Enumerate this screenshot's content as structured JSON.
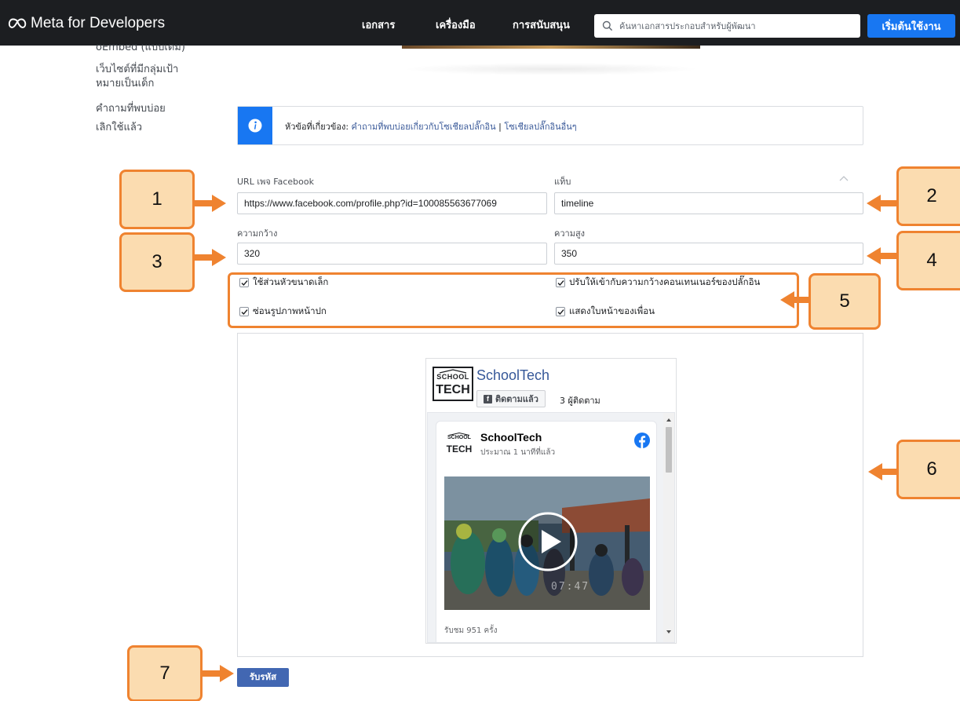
{
  "nav": {
    "brand": "Meta for Developers",
    "links": [
      "เอกสาร",
      "เครื่องมือ",
      "การสนับสนุน"
    ],
    "search_placeholder": "ค้นหาเอกสารประกอบสำหรับผู้พัฒนา",
    "start_button": "เริ่มต้นใช้งาน"
  },
  "sidebar": {
    "items": [
      "oEmbed (แบบเดิม)",
      "เว็บไซต์ที่มีกลุ่มเป้า",
      "หมายเป็นเด็ก",
      "คำถามที่พบบ่อย",
      "เลิกใช้แล้ว"
    ]
  },
  "info": {
    "prefix": "หัวข้อที่เกี่ยวข้อง: ",
    "link1": "คำถามที่พบบ่อยเกี่ยวกับโซเชียลปลั๊กอิน",
    "separator": " | ",
    "link2": "โซเชียลปลั๊กอินอื่นๆ"
  },
  "form": {
    "url_label": "URL เพจ Facebook",
    "url_value": "https://www.facebook.com/profile.php?id=100085563677069",
    "tabs_label": "แท็บ",
    "tabs_value": "timeline",
    "width_label": "ความกว้าง",
    "width_value": "320",
    "height_label": "ความสูง",
    "height_value": "350",
    "checkboxes": [
      {
        "label": "ใช้ส่วนหัวขนาดเล็ก",
        "checked": true
      },
      {
        "label": "ปรับให้เข้ากับความกว้างคอนเทนเนอร์ของปลั๊กอิน",
        "checked": true
      },
      {
        "label": "ซ่อนรูปภาพหน้าปก",
        "checked": true
      },
      {
        "label": "แสดงใบหน้าของเพื่อน",
        "checked": true
      }
    ]
  },
  "preview": {
    "page_name": "SchoolTech",
    "logo_top": "SCHOOL",
    "logo_bottom": "TECH",
    "follow_label": "ติดตามแล้ว",
    "followers": "3 ผู้ติดตาม",
    "post_title": "SchoolTech",
    "post_time": "ประมาณ 1 นาทีที่แล้ว",
    "video_time": "07:47",
    "views": "รับชม 951 ครั้ง"
  },
  "get_code_button": "รับรหัส",
  "annotations": [
    "1",
    "2",
    "3",
    "4",
    "5",
    "6",
    "7"
  ],
  "colors": {
    "nav_bg": "#1c1e21",
    "primary": "#1877f2",
    "callout_fill": "#fbdcb0",
    "callout_border": "#ef8330"
  }
}
